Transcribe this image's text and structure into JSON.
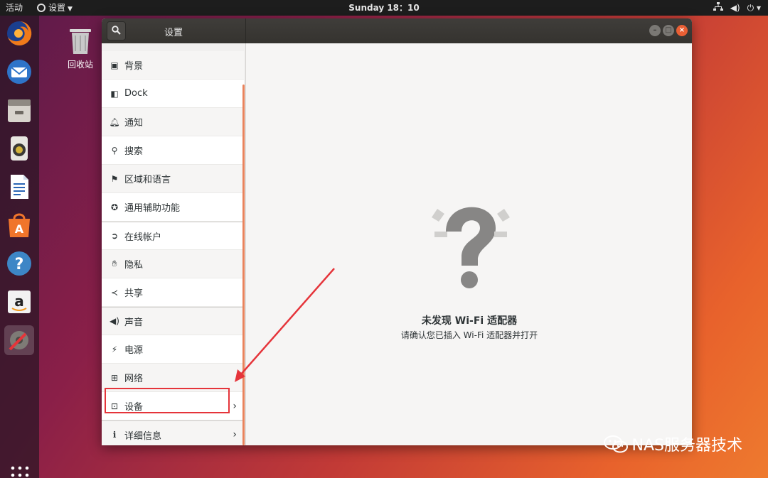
{
  "topbar": {
    "activities": "活动",
    "app_menu": "设置",
    "clock": "Sunday 18：10",
    "icons": [
      "network-icon",
      "volume-icon",
      "power-icon"
    ]
  },
  "desktop": {
    "trash_label": "回收站"
  },
  "dock": {
    "items": [
      "firefox-icon",
      "thunderbird-icon",
      "files-icon",
      "rhythmbox-icon",
      "writer-icon",
      "software-icon",
      "help-icon",
      "amazon-icon",
      "settings-icon"
    ],
    "active": "settings-icon"
  },
  "window": {
    "title": "设置",
    "search_icon": "search-icon",
    "controls": [
      "minimize",
      "maximize",
      "close"
    ]
  },
  "sidebar": {
    "items": [
      {
        "label": "背景",
        "icon": "background-icon"
      },
      {
        "label": "Dock",
        "icon": "dock-icon"
      },
      {
        "label": "通知",
        "icon": "bell-icon"
      },
      {
        "label": "搜索",
        "icon": "search-icon"
      },
      {
        "label": "区域和语言",
        "icon": "region-icon"
      },
      {
        "label": "通用辅助功能",
        "icon": "accessibility-icon"
      },
      {
        "label": "在线帐户",
        "icon": "online-accounts-icon"
      },
      {
        "label": "隐私",
        "icon": "privacy-hand-icon"
      },
      {
        "label": "共享",
        "icon": "share-icon"
      },
      {
        "label": "声音",
        "icon": "sound-icon"
      },
      {
        "label": "电源",
        "icon": "power-plug-icon"
      },
      {
        "label": "网络",
        "icon": "network-icon"
      },
      {
        "label": "设备",
        "icon": "devices-icon"
      },
      {
        "label": "详细信息",
        "icon": "info-icon"
      }
    ]
  },
  "content": {
    "empty_title": "未发现 Wi-Fi 适配器",
    "empty_subtitle": "请确认您已插入 Wi-Fi 适配器并打开"
  },
  "watermark": "NAS服务器技术",
  "colors": {
    "accent": "#e95f34",
    "highlight": "#e5343a",
    "headerbar": "#3b3935"
  }
}
